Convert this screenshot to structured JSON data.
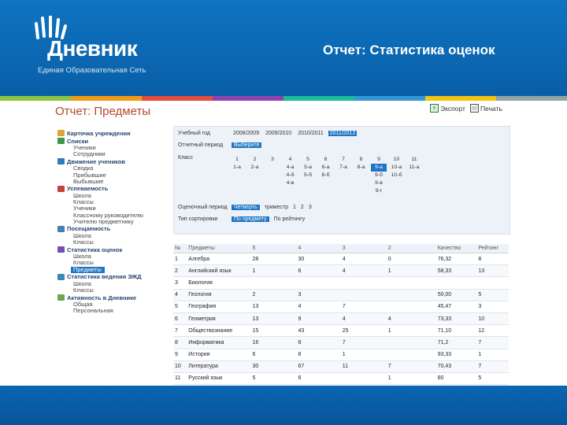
{
  "header": {
    "logo_word": "Дневник",
    "logo_sub": "Единая Образовательная Сеть",
    "title": "Отчет: Статистика оценок"
  },
  "colors": {
    "header": "#0f74c2",
    "stripe": [
      "#8dc63f",
      "#f39c12",
      "#e74c3c",
      "#8e44ad",
      "#1abc9c",
      "#3498db",
      "#f1c40f",
      "#95a5a6"
    ],
    "active": "#1f75c4"
  },
  "page": {
    "title": "Отчет: Предметы",
    "export_label": "Экспорт",
    "print_label": "Печать"
  },
  "sidebar": [
    {
      "label": "Карточка учреждения",
      "icon": "card-icon",
      "items": []
    },
    {
      "label": "Списки",
      "icon": "list-icon",
      "items": [
        "Ученики",
        "Сотрудники"
      ]
    },
    {
      "label": "Движение учеников",
      "icon": "people-icon",
      "items": [
        "Сводка",
        "Прибывшие",
        "Выбывшие"
      ]
    },
    {
      "label": "Успеваемость",
      "icon": "bar-chart-icon",
      "items": [
        "Школа",
        "Классы",
        "Ученики",
        "Классному руководителю",
        "Учителю предметнику"
      ]
    },
    {
      "label": "Посещаемость",
      "icon": "calendar-icon",
      "items": [
        "Школа",
        "Классы"
      ]
    },
    {
      "label": "Статистика оценок",
      "icon": "stats-icon",
      "items": [
        "Школа",
        "Классы",
        "Предметы"
      ]
    },
    {
      "label": "Статистика ведения ЭЖД",
      "icon": "journal-icon",
      "items": [
        "Школа",
        "Классы"
      ]
    },
    {
      "label": "Активность в Дневнике",
      "icon": "activity-icon",
      "items": [
        "Общая",
        "Персональная"
      ]
    }
  ],
  "params": {
    "year_label": "Учебный год",
    "years": [
      "2008/2009",
      "2009/2010",
      "2010/2011",
      "2011/2012"
    ],
    "selected_year": "2011/2012",
    "period_label": "Отчетный период",
    "period_value": "Выберите",
    "class_label": "Класс",
    "classes": [
      {
        "grade": "1",
        "items": [
          "1-а"
        ]
      },
      {
        "grade": "2",
        "items": [
          "2-а"
        ]
      },
      {
        "grade": "3",
        "items": []
      },
      {
        "grade": "4",
        "items": [
          "4-а",
          "4-б",
          "4-в"
        ]
      },
      {
        "grade": "5",
        "items": [
          "5-а",
          "5-б"
        ]
      },
      {
        "grade": "6",
        "items": [
          "6-а",
          "6-б"
        ]
      },
      {
        "grade": "7",
        "items": [
          "7-а"
        ]
      },
      {
        "grade": "8",
        "items": [
          "8-а"
        ]
      },
      {
        "grade": "9",
        "items": [
          "9-а",
          "9-б",
          "9-в",
          "9-г"
        ]
      },
      {
        "grade": "10",
        "items": [
          "10-а",
          "10-б"
        ]
      },
      {
        "grade": "11",
        "items": [
          "11-а"
        ]
      }
    ],
    "selected_class": "9-а",
    "scale_label": "Оценочный период",
    "scale_selected": "Четверть",
    "scale_note": "триместр",
    "scale_numbers": [
      "1",
      "2",
      "3"
    ],
    "sort_label": "Тип сортировки",
    "sort_selected": "По предмету",
    "sort_other": "По рейтингу"
  },
  "table": {
    "headers": [
      "№",
      "Предметы",
      "5",
      "4",
      "3",
      "2",
      "Качество",
      "Рейтинг"
    ],
    "rows": [
      [
        "1",
        "Алгебра",
        "28",
        "30",
        "4",
        "0",
        "76,32",
        "8"
      ],
      [
        "2",
        "Английский язык",
        "1",
        "6",
        "4",
        "1",
        "58,33",
        "13"
      ],
      [
        "3",
        "Биология",
        "",
        "",
        "",
        "",
        "",
        ""
      ],
      [
        "4",
        "Геология",
        "2",
        "3",
        "",
        "",
        "50,00",
        "5"
      ],
      [
        "5",
        "География",
        "13",
        "4",
        "7",
        "",
        "45,47",
        "3"
      ],
      [
        "6",
        "Геометрия",
        "13",
        "9",
        "4",
        "4",
        "73,33",
        "10"
      ],
      [
        "7",
        "Обществознание",
        "15",
        "43",
        "25",
        "1",
        "71,10",
        "12"
      ],
      [
        "8",
        "Информатика",
        "16",
        "8",
        "7",
        "",
        "71,2",
        "7"
      ],
      [
        "9",
        "История",
        "6",
        "8",
        "1",
        "",
        "93,33",
        "1"
      ],
      [
        "10",
        "Литература",
        "30",
        "67",
        "11",
        "7",
        "70,43",
        "7"
      ],
      [
        "11",
        "Русский язык",
        "5",
        "6",
        "",
        "1",
        "80",
        "5"
      ]
    ]
  }
}
